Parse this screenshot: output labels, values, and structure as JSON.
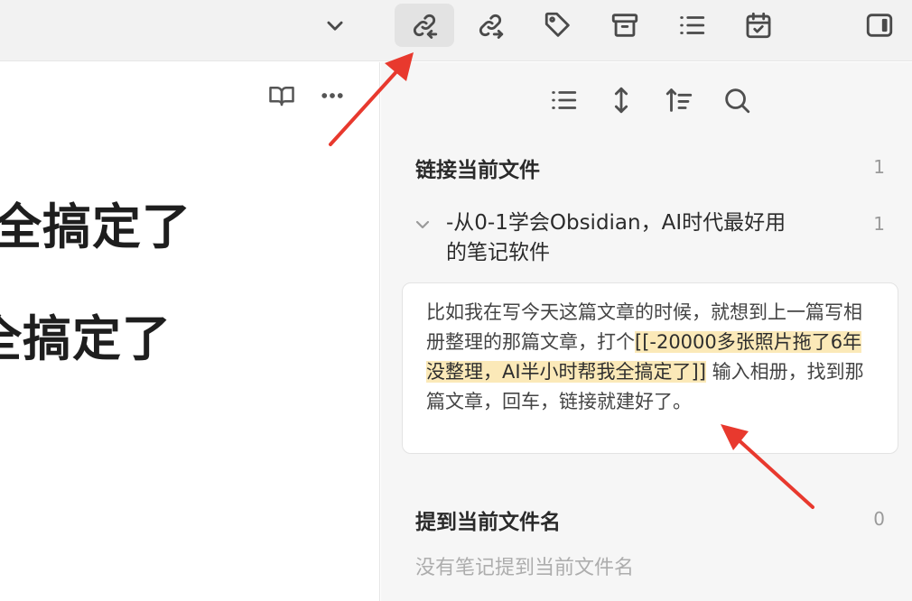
{
  "toolbar": {
    "buttons": [
      {
        "icon": "link-incoming-icon",
        "active": true
      },
      {
        "icon": "link-outgoing-icon",
        "active": false
      },
      {
        "icon": "tag-icon",
        "active": false
      },
      {
        "icon": "archive-icon",
        "active": false
      },
      {
        "icon": "list-icon",
        "active": false
      },
      {
        "icon": "calendar-check-icon",
        "active": false
      },
      {
        "icon": "sidebar-toggle-icon",
        "active": false
      }
    ]
  },
  "editor": {
    "heading_line_1": "全搞定了",
    "heading_line_2": "全搞定了"
  },
  "backlinks": {
    "linked_title": "链接当前文件",
    "linked_count": "1",
    "file": {
      "title": "-从0-1学会Obsidian，AI时代最好用的笔记软件",
      "count": "1"
    },
    "snippet": {
      "before": "比如我在写今天这篇文章的时候，就想到上一篇写相册整理的那篇文章，打个",
      "link": "[[-20000多张照片拖了6年没整理，AI半小时帮我全搞定了]]",
      "after": " 输入相册，找到那篇文章，回车，链接就建好了。"
    },
    "unlinked_title": "提到当前文件名",
    "unlinked_count": "0",
    "unlinked_empty": "没有笔记提到当前文件名"
  },
  "colors": {
    "highlight": "#fbe9b8",
    "annotation_arrow": "#e8392e"
  }
}
